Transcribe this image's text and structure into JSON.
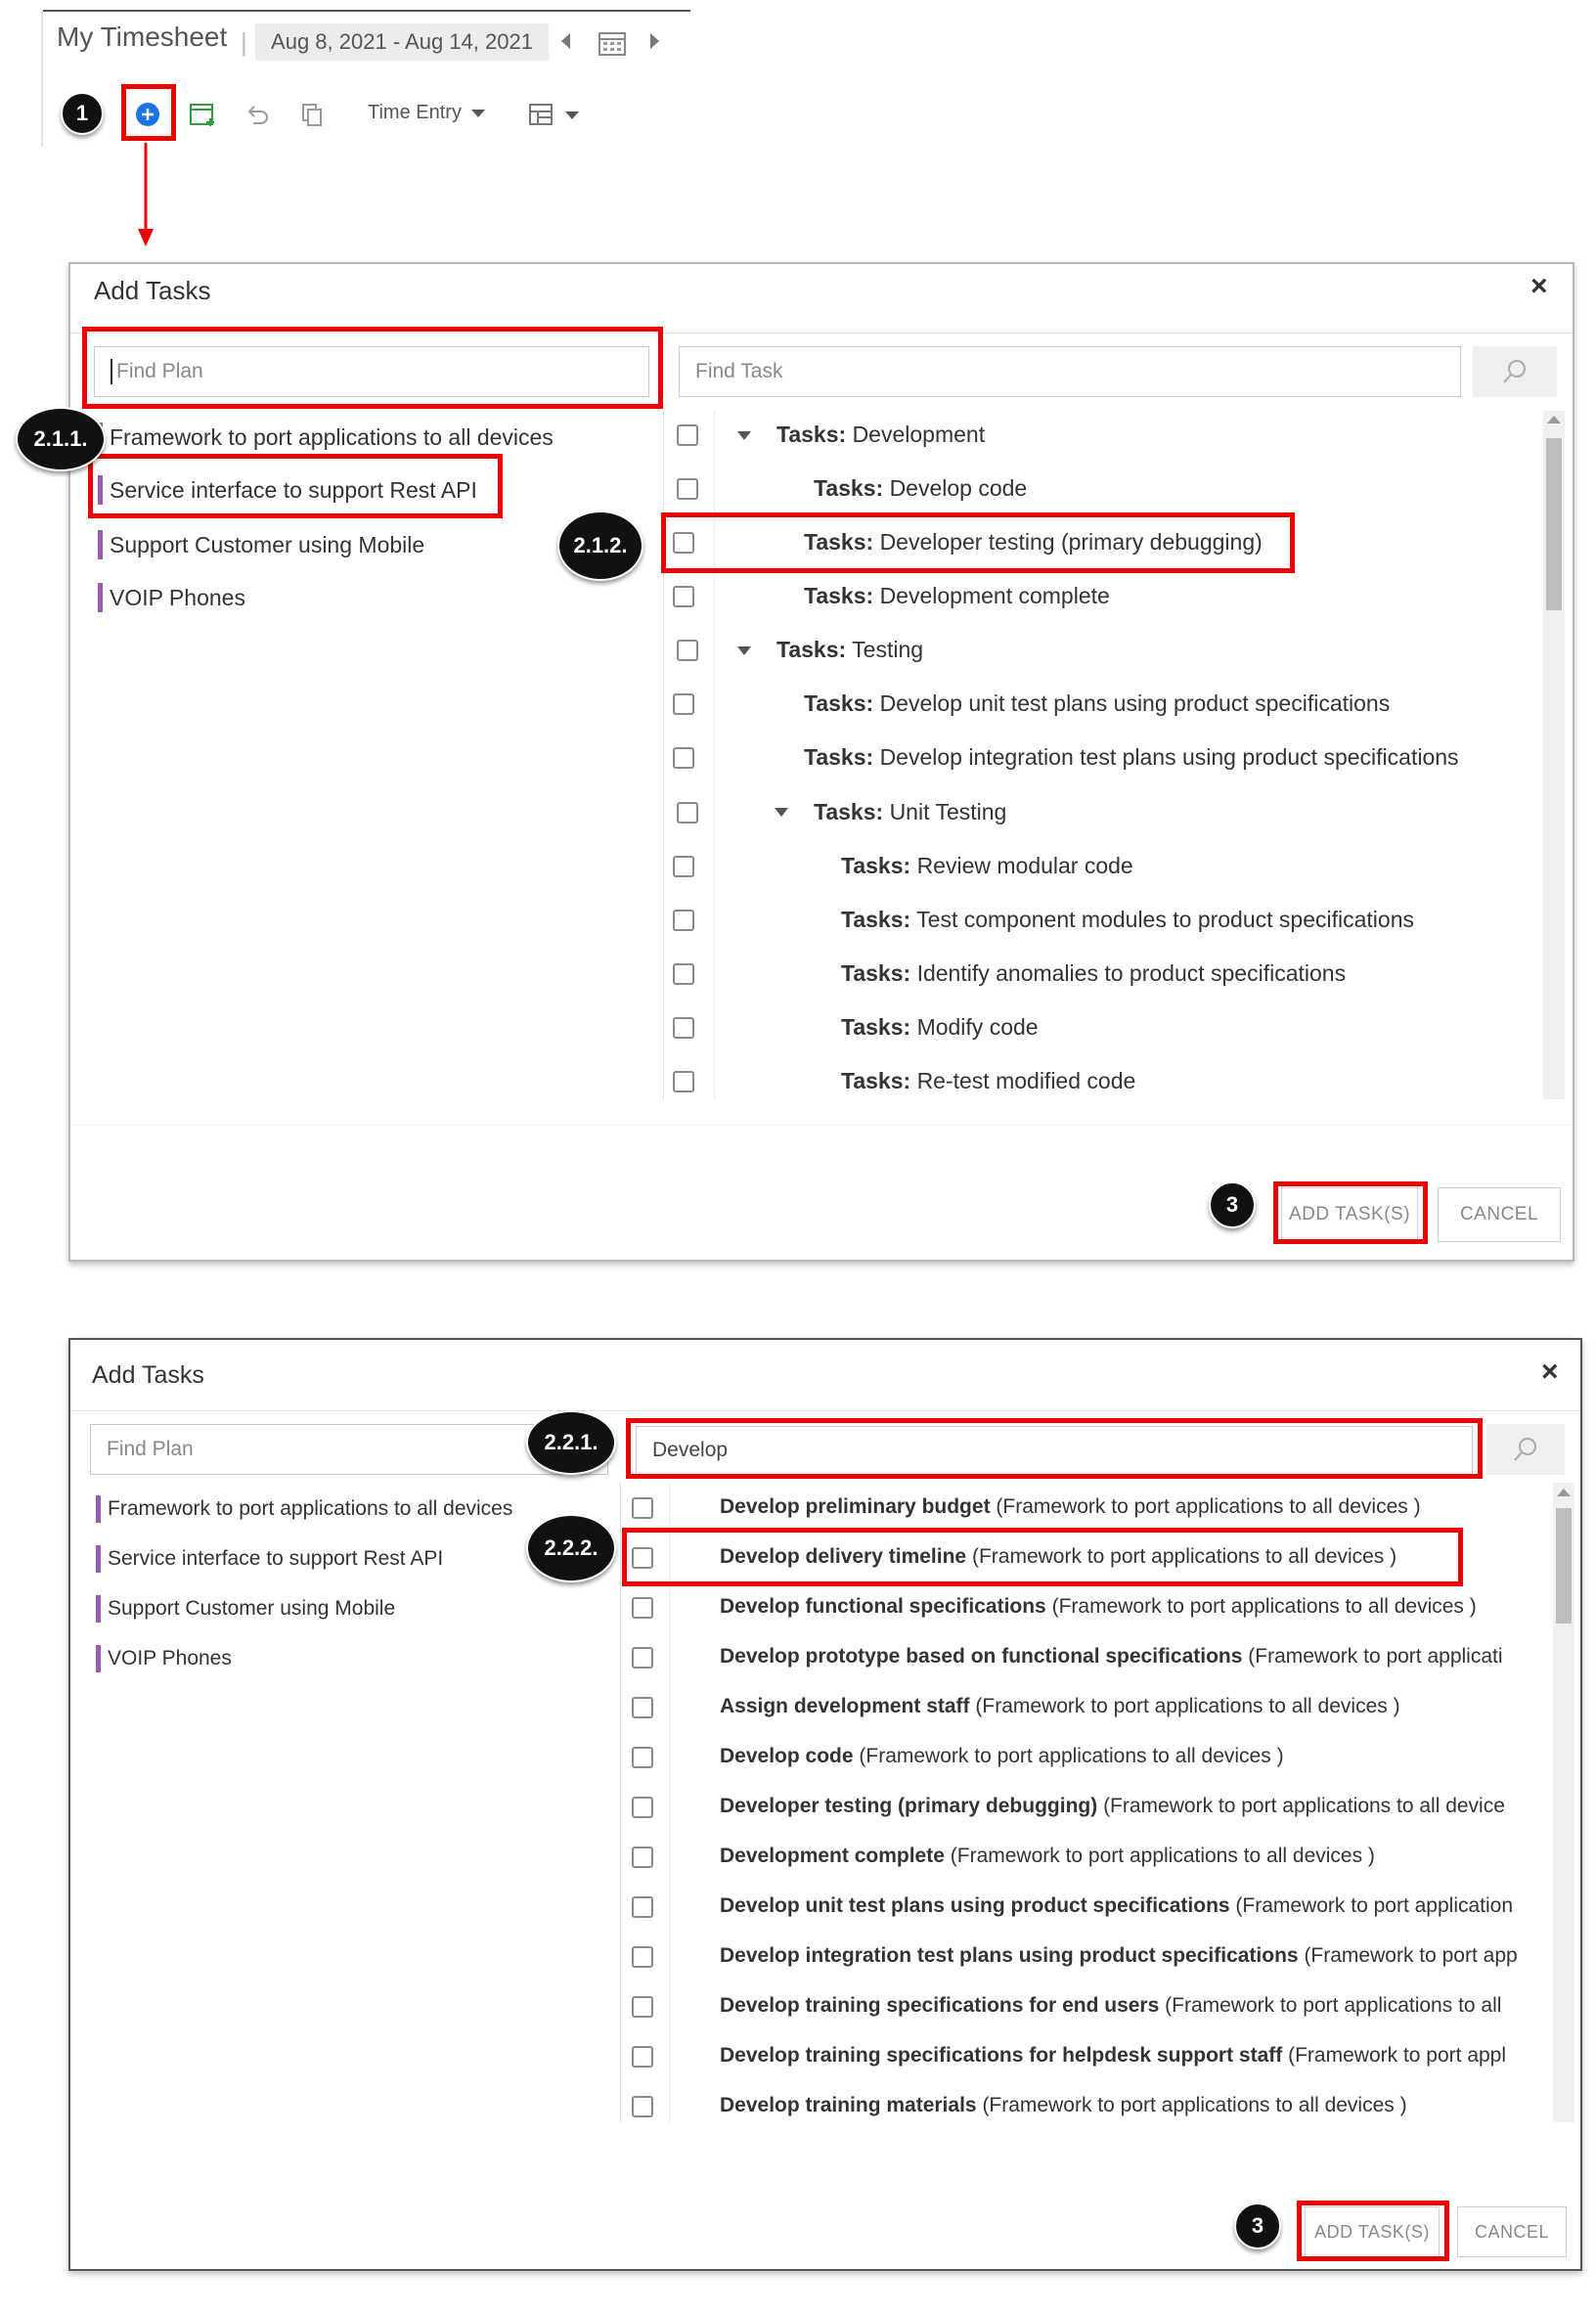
{
  "header": {
    "title": "My Timesheet",
    "separator": "|",
    "date_range": "Aug 8, 2021 - Aug 14, 2021",
    "time_entry_label": "Time Entry"
  },
  "annotations": {
    "step1": "1",
    "s211": "2.1.1.",
    "s212": "2.1.2.",
    "s3a": "3",
    "s221": "2.2.1.",
    "s222": "2.2.2.",
    "s3b": "3"
  },
  "dialog1": {
    "title": "Add Tasks",
    "close": "×",
    "find_plan_placeholder": "Find Plan",
    "find_task_placeholder": "Find Task",
    "plans": [
      "Framework to port applications to all devices",
      "Service interface to support Rest API",
      "Support Customer using Mobile",
      "VOIP Phones"
    ],
    "task_prefix": "Tasks:",
    "tasks": [
      "Development",
      "Develop code",
      "Developer testing (primary debugging)",
      "Development complete",
      "Testing",
      "Develop unit test plans using product specifications",
      "Develop integration test plans using product specifications",
      "Unit Testing",
      "Review modular code",
      "Test component modules to product specifications",
      "Identify anomalies to product specifications",
      "Modify code",
      "Re-test modified code"
    ],
    "add_button": "ADD TASK(S)",
    "cancel_button": "CANCEL"
  },
  "dialog2": {
    "title": "Add Tasks",
    "close": "×",
    "find_plan_placeholder": "Find Plan",
    "search_value": "Develop",
    "plans": [
      "Framework to port applications to all devices",
      "Service interface to support Rest API",
      "Support Customer using Mobile",
      "VOIP Phones"
    ],
    "results": [
      {
        "name": "Develop preliminary budget",
        "plan": "(Framework to port applications to all devices )"
      },
      {
        "name": "Develop delivery timeline",
        "plan": "(Framework to port applications to all devices )"
      },
      {
        "name": "Develop functional specifications",
        "plan": "(Framework to port applications to all devices )"
      },
      {
        "name": "Develop prototype based on functional specifications",
        "plan": "(Framework to port applicati"
      },
      {
        "name": "Assign development staff",
        "plan": "(Framework to port applications to all devices )"
      },
      {
        "name": "Develop code",
        "plan": "(Framework to port applications to all devices )"
      },
      {
        "name": "Developer testing (primary debugging)",
        "plan": "(Framework to port applications to all device"
      },
      {
        "name": "Development complete",
        "plan": "(Framework to port applications to all devices )"
      },
      {
        "name": "Develop unit test plans using product specifications",
        "plan": "(Framework to port application"
      },
      {
        "name": "Develop integration test plans using product specifications",
        "plan": "(Framework to port app"
      },
      {
        "name": "Develop training specifications for end users",
        "plan": "(Framework to port applications to all"
      },
      {
        "name": "Develop training specifications for helpdesk support staff",
        "plan": "(Framework to port appl"
      },
      {
        "name": "Develop training materials",
        "plan": "(Framework to port applications to all devices )"
      }
    ],
    "add_button": "ADD TASK(S)",
    "cancel_button": "CANCEL"
  },
  "colors": {
    "annotation_red": "#ee0000",
    "plan_accent": "#9b59b6",
    "add_icon_blue": "#1a73e8",
    "timesheet_icon_green": "#2e9e3f"
  }
}
